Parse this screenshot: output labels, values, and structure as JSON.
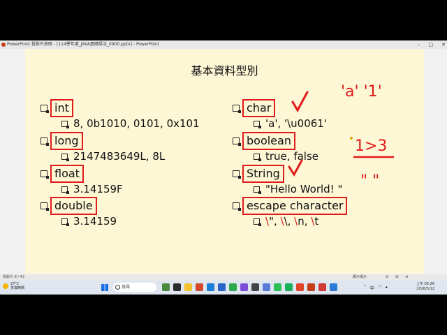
{
  "window": {
    "title": "PowerPoint 投影片放映 - [114學年度_JAVA基礎語法_0900.pptx] - PowerPoint",
    "controls": [
      "–",
      "□",
      "✕"
    ]
  },
  "slide": {
    "title": "基本資料型別",
    "left_items": [
      {
        "label": "int",
        "example": "8, 0b1010, 0101, 0x101"
      },
      {
        "label": "long",
        "example": "2147483649L, 8L"
      },
      {
        "label": "float",
        "example": "3.14159F"
      },
      {
        "label": "double",
        "example": "3.14159"
      }
    ],
    "right_items": [
      {
        "label": "char",
        "example": "'a', '\\u0061'"
      },
      {
        "label": "boolean",
        "example": "true, false"
      },
      {
        "label": "String",
        "example": "\"Hello World! \""
      },
      {
        "label": "escape character",
        "example_parts": [
          "\\",
          "\", ",
          "\\",
          "\\, ",
          "\\",
          "n, ",
          "\\",
          "t"
        ]
      }
    ],
    "annotations": {
      "quotes_text": "'a' '1'",
      "compare_text": "1>3",
      "dquotes_text": "\"  \""
    }
  },
  "status": {
    "slide_indicator": "投影片 8 / 43",
    "notes_label": "顯示提示",
    "zoom_icons": [
      "⊟",
      "⊞",
      "⊕"
    ]
  },
  "taskbar": {
    "weather_temp": "27°C",
    "weather_desc": "多雲時晴",
    "search_placeholder": "搜尋",
    "tray_time": "上午 05:26",
    "tray_date": "2026/5/12",
    "tray_lang": "中",
    "colors": {
      "accent": "#e01b1b",
      "slide_bg": "#fdf7d6"
    }
  }
}
